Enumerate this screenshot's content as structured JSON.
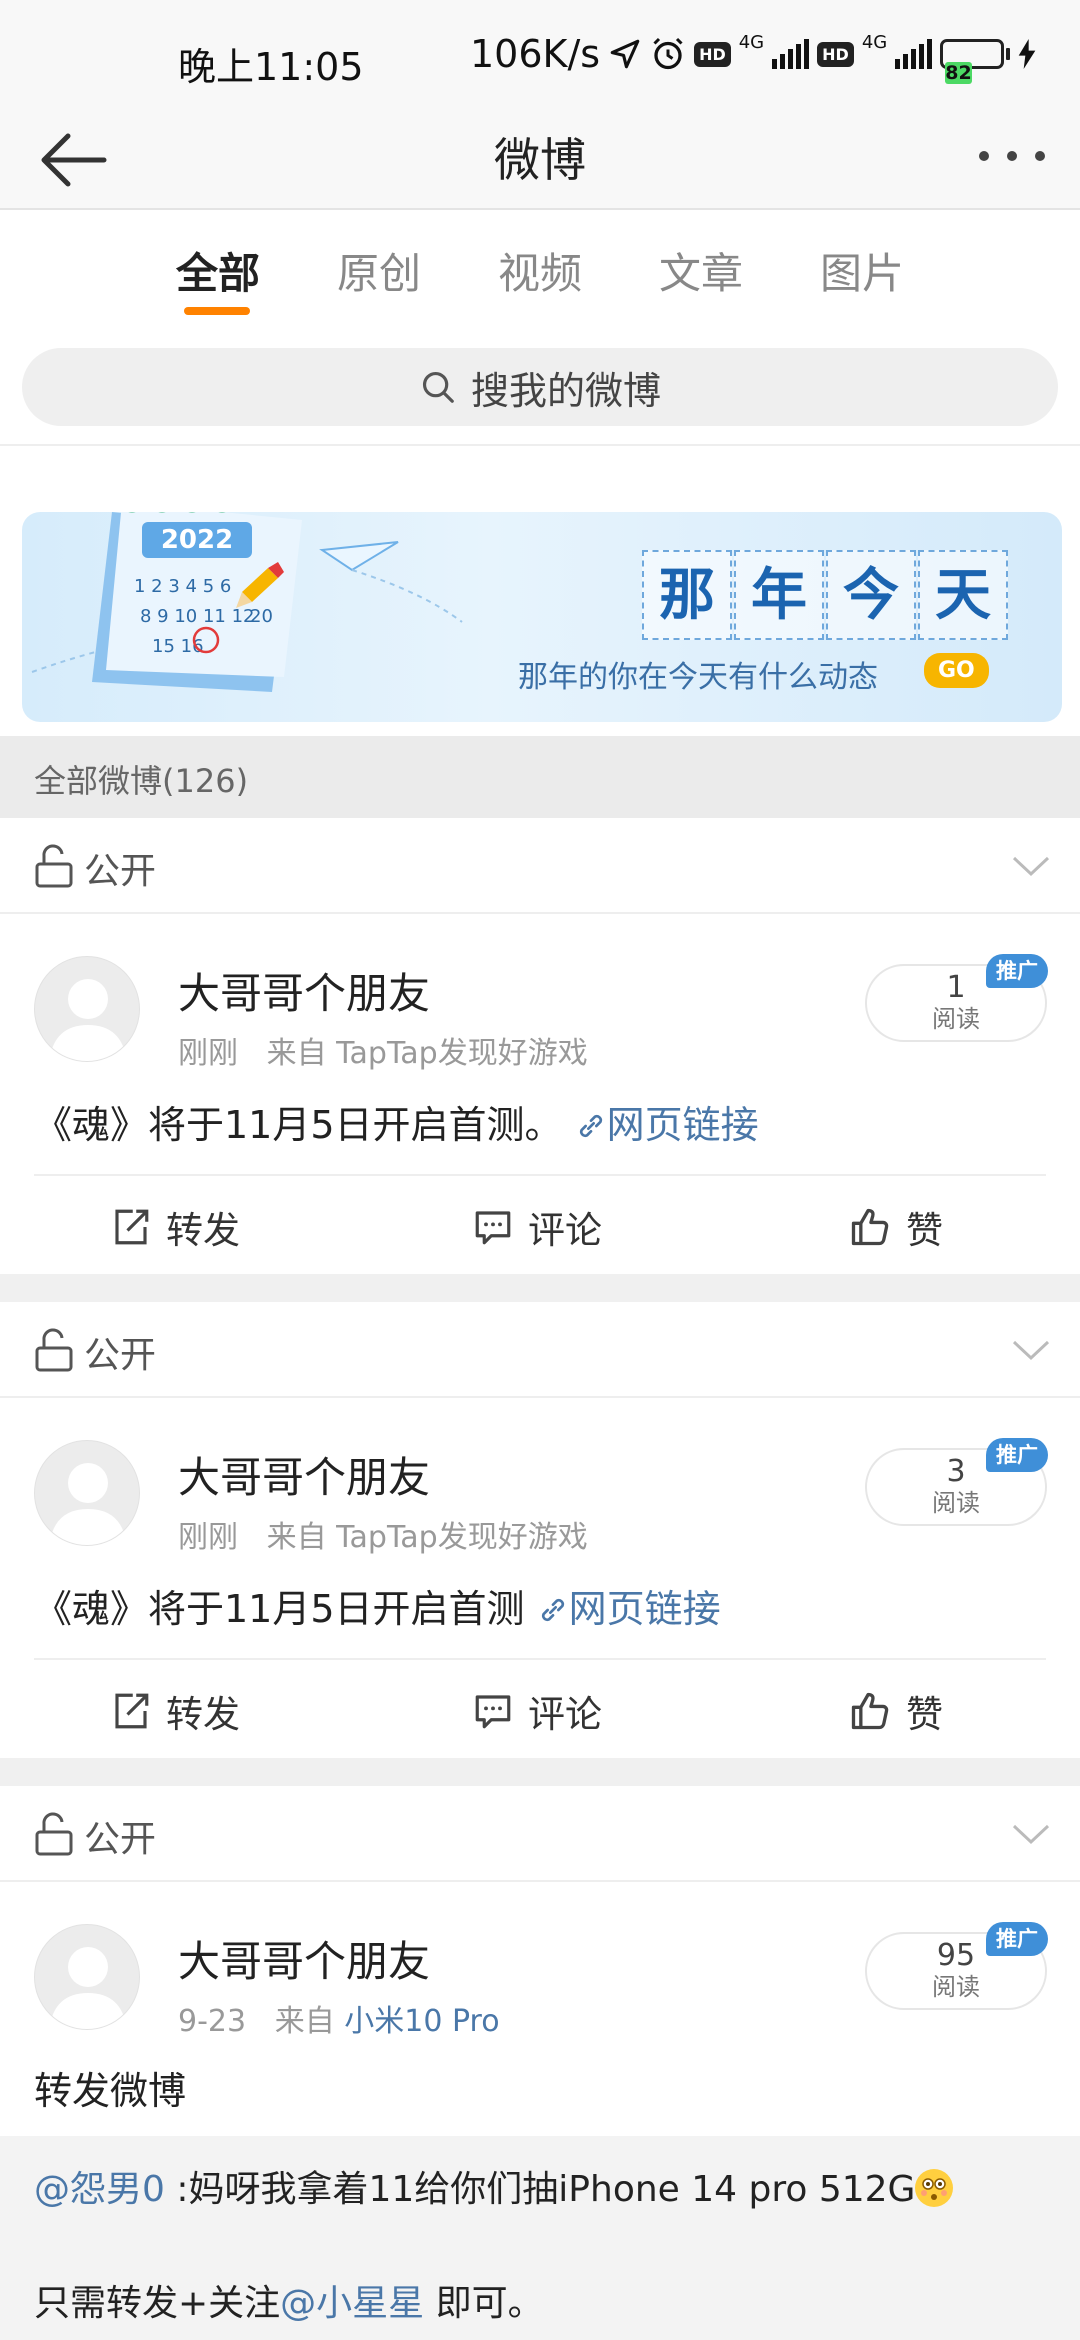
{
  "status_bar": {
    "time": "晚上11:05",
    "speed": "106K/s",
    "hd1": "HD",
    "net1": "4G",
    "hd2": "HD",
    "net2": "4G",
    "battery": "82",
    "battery_color": "#4cd964"
  },
  "nav": {
    "title": "微博",
    "back_icon": "arrow-left-icon",
    "more_icon": "more-dots-icon"
  },
  "tabs": [
    {
      "label": "全部",
      "active": true
    },
    {
      "label": "原创",
      "active": false
    },
    {
      "label": "视频",
      "active": false
    },
    {
      "label": "文章",
      "active": false
    },
    {
      "label": "图片",
      "active": false
    }
  ],
  "accent_color": "#ff8200",
  "search": {
    "placeholder": "搜我的微博"
  },
  "banner": {
    "calendar_year": "2022",
    "title_chars": [
      "那",
      "年",
      "今",
      "天"
    ],
    "subtitle": "那年的你在今天有什么动态",
    "go_label": "GO"
  },
  "section": {
    "title": "全部微博(126)"
  },
  "posts": [
    {
      "privacy": "公开",
      "author": "大哥哥个朋友",
      "time": "刚刚",
      "source_prefix": "来自",
      "source": "TapTap发现好游戏",
      "reads": "1",
      "reads_label": "阅读",
      "promo": "推广",
      "text": "《魂》将于11月5日开启首测。",
      "link": "网页链接",
      "actions": {
        "repost": "转发",
        "comment": "评论",
        "like": "赞"
      }
    },
    {
      "privacy": "公开",
      "author": "大哥哥个朋友",
      "time": "刚刚",
      "source_prefix": "来自",
      "source": "TapTap发现好游戏",
      "reads": "3",
      "reads_label": "阅读",
      "promo": "推广",
      "text": "《魂》将于11月5日开启首测",
      "link": "网页链接",
      "actions": {
        "repost": "转发",
        "comment": "评论",
        "like": "赞"
      }
    },
    {
      "privacy": "公开",
      "author": "大哥哥个朋友",
      "time": "9-23",
      "source_prefix": "来自",
      "source": "小米10 Pro",
      "reads": "95",
      "reads_label": "阅读",
      "promo": "推广",
      "text": "转发微博",
      "repost": {
        "mention1": "@怨男0",
        "line1": " :妈呀我拿着11给你们抽iPhone 14 pro 512G",
        "line2_prefix": "只需转发+关注",
        "mention2": "@小星星",
        "line2_suffix": " 即可。"
      }
    }
  ]
}
